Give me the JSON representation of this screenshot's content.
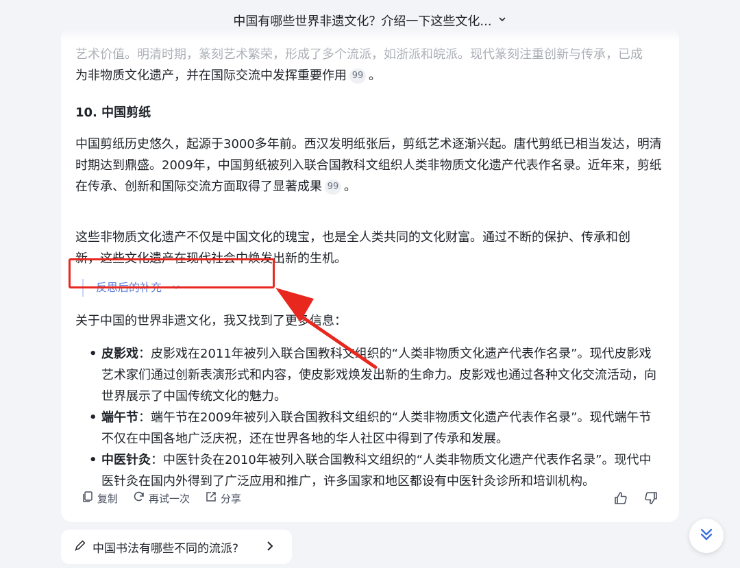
{
  "header": {
    "title": "中国有哪些世界非遗文化？介绍一下这些文化..."
  },
  "answer": {
    "top_para_line1": "艺术价值。明清时期，篆刻艺术繁荣，形成了多个流派，如浙派和皖派。现代篆刻注重创新与传承，已成",
    "top_para_line2": "为非物质文化遗产，并在国际交流中发挥重要作用",
    "top_para_end": "。",
    "section_heading": "10. 中国剪纸",
    "papercut_para": "中国剪纸历史悠久，起源于3000多年前。西汉发明纸张后，剪纸艺术逐渐兴起。唐代剪纸已相当发达，明清时期达到鼎盛。2009年，中国剪纸被列入联合国教科文组织人类非物质文化遗产代表作名录。近年来，剪纸在传承、创新和国际交流方面取得了显著成果",
    "papercut_end": "。",
    "summary_para": "这些非物质文化遗产不仅是中国文化的瑰宝，也是全人类共同的文化财富。通过不断的保护、传承和创新，这些文化遗产在现代社会中焕发出新的生机。",
    "citation_glyph": "99",
    "reflection_label": "反思后的补充",
    "intro": "关于中国的世界非遗文化，我又找到了更多信息：",
    "items": [
      {
        "term": "皮影戏",
        "text": "：皮影戏在2011年被列入联合国教科文组织的“人类非物质文化遗产代表作名录”。现代皮影戏艺术家们通过创新表演形式和内容，使皮影戏焕发出新的生命力。皮影戏也通过各种文化交流活动，向世界展示了中国传统文化的魅力。"
      },
      {
        "term": "端午节",
        "text": "：端午节在2009年被列入联合国教科文组织的“人类非物质文化遗产代表作名录”。现代端午节不仅在中国各地广泛庆祝，还在世界各地的华人社区中得到了传承和发展。"
      },
      {
        "term": "中医针灸",
        "text": "：中医针灸在2010年被列入联合国教科文组织的“人类非物质文化遗产代表作名录”。现代中医针灸在国内外得到了广泛应用和推广，许多国家和地区都设有中医针灸诊所和培训机构。"
      }
    ]
  },
  "actions": {
    "copy": "复制",
    "retry": "再试一次",
    "share": "分享"
  },
  "suggestion": {
    "text": "中国书法有哪些不同的流派?"
  },
  "colors": {
    "annotation_red": "#e8281e",
    "reflect_blue": "#5b7fd6",
    "scroll_icon_blue": "#3b6fe0"
  }
}
